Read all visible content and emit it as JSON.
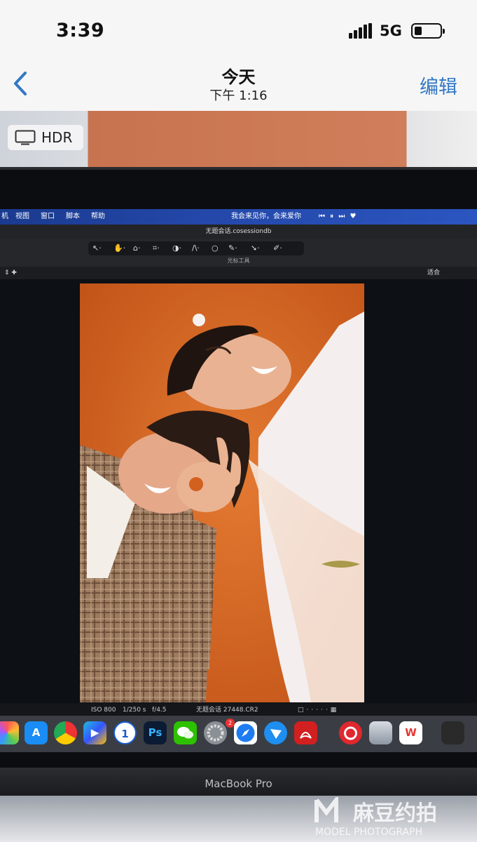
{
  "status_bar": {
    "time": "3:39",
    "network": "5G",
    "battery_level": 0.28
  },
  "nav": {
    "title": "今天",
    "subtitle": "下午 1:16",
    "edit_label": "编辑"
  },
  "photo_badge": {
    "label": "HDR"
  },
  "mac_menu": {
    "items": [
      "机",
      "视图",
      "窗口",
      "脚本",
      "帮助"
    ],
    "status_text": "我会来见你，会来爱你",
    "media_controls": "⏮ ⏸ ⏭ ♥"
  },
  "app": {
    "window_title": "无题会话.cosessiondb",
    "tool_caption": "光标工具",
    "tools": [
      "↖·",
      "✋·",
      "⌂·",
      "⌗·",
      "◑·",
      "/\\·",
      "○",
      "✎·",
      "➘·",
      "✐·"
    ],
    "viewer_left": "⇕ ✚",
    "viewer_right": "适合"
  },
  "info_bar": {
    "iso": "ISO 800",
    "shutter": "1/250 s",
    "aperture": "f/4.5",
    "filename": "无题会话 27448.CR2"
  },
  "dock": {
    "icons": [
      {
        "name": "photos-icon",
        "label": ""
      },
      {
        "name": "app-store-icon",
        "label": "A"
      },
      {
        "name": "chrome-icon",
        "label": ""
      },
      {
        "name": "video-player-icon",
        "label": "▶"
      },
      {
        "name": "1password-icon",
        "label": "1"
      },
      {
        "name": "photoshop-icon",
        "label": "Ps"
      },
      {
        "name": "wechat-icon",
        "label": ""
      },
      {
        "name": "system-settings-icon",
        "label": ""
      },
      {
        "name": "safari-icon",
        "label": ""
      },
      {
        "name": "feishu-icon",
        "label": ""
      },
      {
        "name": "acrobat-icon",
        "label": ""
      },
      {
        "name": "netease-music-icon",
        "label": ""
      },
      {
        "name": "preview-icon",
        "label": ""
      },
      {
        "name": "wps-icon",
        "label": "W"
      },
      {
        "name": "photo-booth-icon",
        "label": ""
      }
    ],
    "badge_count": "2"
  },
  "laptop": {
    "model_label": "MacBook Pro"
  },
  "watermark": {
    "brand": "麻豆约拍",
    "sub": "MODEL PHOTOGRAPH"
  },
  "colors": {
    "ios_blue": "#3278c4",
    "backdrop_orange": "#d2601f",
    "menubar_blue": "#2347a8"
  }
}
